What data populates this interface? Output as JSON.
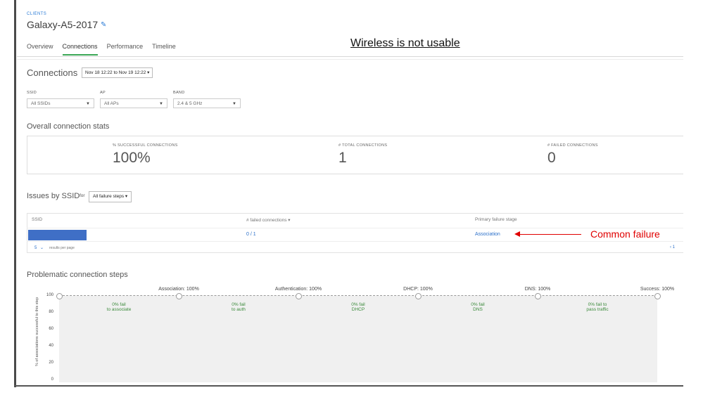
{
  "header": {
    "breadcrumb": "CLIENTS",
    "title": "Galaxy-A5-2017",
    "headline": "Wireless is not usable"
  },
  "tabs": [
    {
      "label": "Overview",
      "active": false
    },
    {
      "label": "Connections",
      "active": true
    },
    {
      "label": "Performance",
      "active": false
    },
    {
      "label": "Timeline",
      "active": false
    }
  ],
  "connections": {
    "title": "Connections",
    "date_range": "Nov 18 12:22 to Nov 19 12:22 ▾"
  },
  "filters": [
    {
      "label": "SSID",
      "value": "All SSIDs"
    },
    {
      "label": "AP",
      "value": "All APs"
    },
    {
      "label": "BAND",
      "value": "2.4 & 5 GHz"
    }
  ],
  "overall": {
    "title": "Overall connection stats",
    "stats": [
      {
        "label": "% SUCCESSFUL CONNECTIONS",
        "value": "100%"
      },
      {
        "label": "# TOTAL CONNECTIONS",
        "value": "1"
      },
      {
        "label": "# FAILED CONNECTIONS",
        "value": "0"
      }
    ]
  },
  "issues": {
    "title": "Issues by SSID",
    "for_label": "for",
    "filter": "All failure steps ▾",
    "columns": [
      "SSID",
      "# failed connections ▾",
      "Primary failure stage"
    ],
    "row": {
      "ssid": "",
      "failed": "0 / 1",
      "stage": "Association"
    },
    "page_size": "5",
    "per_page_label": "results per page",
    "pager": "‹ 1"
  },
  "annotation": {
    "text": "Common failure",
    "color": "#e00000"
  },
  "chart_data": {
    "type": "area",
    "title": "Problematic connection steps",
    "ylabel": "% of associations successful to this step",
    "yticks": [
      "100",
      "80",
      "60",
      "40",
      "20",
      "0"
    ],
    "ylim": [
      0,
      100
    ],
    "steps": [
      {
        "label": "",
        "value": 100
      },
      {
        "label": "Association: 100%",
        "value": 100
      },
      {
        "label": "Authentication: 100%",
        "value": 100
      },
      {
        "label": "DHCP: 100%",
        "value": 100
      },
      {
        "label": "DNS: 100%",
        "value": 100
      },
      {
        "label": "Success: 100%",
        "value": 100
      }
    ],
    "fail_labels": [
      {
        "line1": "0% fail",
        "line2": "to associate"
      },
      {
        "line1": "0% fail",
        "line2": "to auth"
      },
      {
        "line1": "0% fail",
        "line2": "DHCP"
      },
      {
        "line1": "0% fail",
        "line2": "DNS"
      },
      {
        "line1": "0% fail to",
        "line2": "pass traffic"
      }
    ],
    "fill_color": "#f0f0f0",
    "fail_color": "#3a8a3a"
  },
  "colors": {
    "accent": "#2a7bd6",
    "tab_active": "#3aa655",
    "ssid_block": "#3f6fc6"
  }
}
